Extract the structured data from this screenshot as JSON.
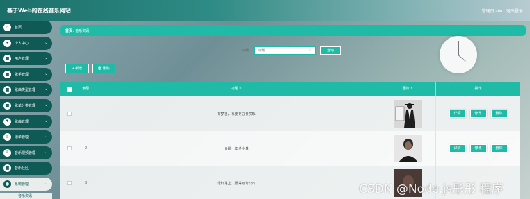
{
  "header": {
    "site_title": "基于Web的在线音乐网站",
    "admin_label": "管理员 abo",
    "logout_label": "退出登录"
  },
  "sidebar": {
    "items": [
      {
        "label": "首页",
        "icon": "home-icon",
        "glyph": "⌂",
        "has_chevron": false
      },
      {
        "label": "个人中心",
        "icon": "user-icon",
        "glyph": "●",
        "has_chevron": true
      },
      {
        "label": "用户管理",
        "icon": "grid-icon",
        "glyph": "▦",
        "has_chevron": true
      },
      {
        "label": "歌手管理",
        "icon": "grid-icon",
        "glyph": "▦",
        "has_chevron": true
      },
      {
        "label": "歌曲类型管理",
        "icon": "grid-icon",
        "glyph": "▦",
        "has_chevron": true
      },
      {
        "label": "歌单分类管理",
        "icon": "grid-icon",
        "glyph": "▦",
        "has_chevron": true
      },
      {
        "label": "歌曲管理",
        "icon": "pin-icon",
        "glyph": "▼",
        "has_chevron": true
      },
      {
        "label": "歌单管理",
        "icon": "list-icon",
        "glyph": "≡",
        "has_chevron": true
      },
      {
        "label": "音乐视频管理",
        "icon": "list-icon",
        "glyph": "≡",
        "has_chevron": true
      },
      {
        "label": "音乐社区",
        "icon": "grid-icon",
        "glyph": "▦",
        "has_chevron": false
      },
      {
        "label": "系统管理",
        "icon": "settings-icon",
        "glyph": "◉",
        "has_chevron": true
      }
    ],
    "sub_item": "音乐资讯"
  },
  "breadcrumb": {
    "home": "首页",
    "separator": "/",
    "current": "音乐资讯"
  },
  "search": {
    "label": "标题",
    "placeholder": "标题",
    "button": "查询"
  },
  "actions": {
    "add": "+ 新增",
    "delete": "🗑 删除"
  },
  "table": {
    "headers": {
      "index": "索引",
      "title": "标题 ⇕",
      "image": "图片 ⇕",
      "ops": "操作"
    },
    "rows": [
      {
        "index": "1",
        "title": "有梦想，就要努力去实现"
      },
      {
        "index": "2",
        "title": "又是一年毕业季"
      },
      {
        "index": "3",
        "title": "绿灯路上，愿得有你公司"
      }
    ],
    "op_labels": {
      "detail": "详情",
      "edit": "修改",
      "delete": "删除"
    }
  },
  "watermark": "CSDN @Node.js彤彤 程序"
}
